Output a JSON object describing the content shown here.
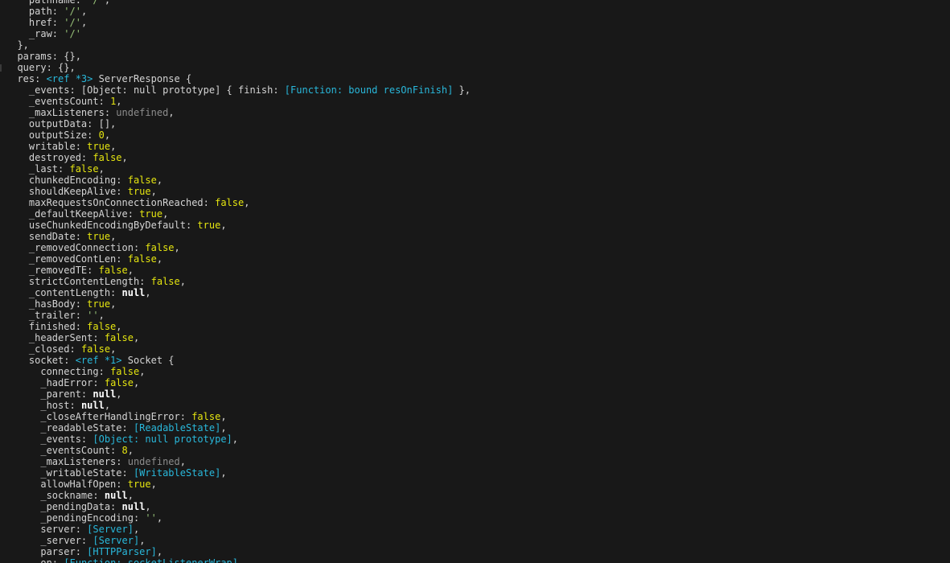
{
  "terminal": {
    "lines": [
      {
        "indent": 4,
        "segs": [
          {
            "c": "p",
            "t": "pathname: "
          },
          {
            "c": "s",
            "t": "'/'"
          },
          {
            "c": "p",
            "t": ","
          }
        ]
      },
      {
        "indent": 4,
        "segs": [
          {
            "c": "p",
            "t": "path: "
          },
          {
            "c": "s",
            "t": "'/'"
          },
          {
            "c": "p",
            "t": ","
          }
        ]
      },
      {
        "indent": 4,
        "segs": [
          {
            "c": "p",
            "t": "href: "
          },
          {
            "c": "s",
            "t": "'/'"
          },
          {
            "c": "p",
            "t": ","
          }
        ]
      },
      {
        "indent": 4,
        "segs": [
          {
            "c": "p",
            "t": "_raw: "
          },
          {
            "c": "s",
            "t": "'/'"
          }
        ]
      },
      {
        "indent": 2,
        "segs": [
          {
            "c": "p",
            "t": "},"
          }
        ]
      },
      {
        "indent": 2,
        "segs": [
          {
            "c": "p",
            "t": "params: {},"
          }
        ]
      },
      {
        "indent": 2,
        "segs": [
          {
            "c": "p",
            "t": "query: {},"
          }
        ]
      },
      {
        "indent": 2,
        "segs": [
          {
            "c": "p",
            "t": "res: "
          },
          {
            "c": "r",
            "t": "<ref *3>"
          },
          {
            "c": "p",
            "t": " ServerResponse {"
          }
        ]
      },
      {
        "indent": 4,
        "segs": [
          {
            "c": "p",
            "t": "_events: [Object: null prototype] { finish: "
          },
          {
            "c": "r",
            "t": "[Function: bound resOnFinish]"
          },
          {
            "c": "p",
            "t": " },"
          }
        ]
      },
      {
        "indent": 4,
        "segs": [
          {
            "c": "p",
            "t": "_eventsCount: "
          },
          {
            "c": "n",
            "t": "1"
          },
          {
            "c": "p",
            "t": ","
          }
        ]
      },
      {
        "indent": 4,
        "segs": [
          {
            "c": "p",
            "t": "_maxListeners: "
          },
          {
            "c": "u",
            "t": "undefined"
          },
          {
            "c": "p",
            "t": ","
          }
        ]
      },
      {
        "indent": 4,
        "segs": [
          {
            "c": "p",
            "t": "outputData: [],"
          }
        ]
      },
      {
        "indent": 4,
        "segs": [
          {
            "c": "p",
            "t": "outputSize: "
          },
          {
            "c": "n",
            "t": "0"
          },
          {
            "c": "p",
            "t": ","
          }
        ]
      },
      {
        "indent": 4,
        "segs": [
          {
            "c": "p",
            "t": "writable: "
          },
          {
            "c": "n",
            "t": "true"
          },
          {
            "c": "p",
            "t": ","
          }
        ]
      },
      {
        "indent": 4,
        "segs": [
          {
            "c": "p",
            "t": "destroyed: "
          },
          {
            "c": "n",
            "t": "false"
          },
          {
            "c": "p",
            "t": ","
          }
        ]
      },
      {
        "indent": 4,
        "segs": [
          {
            "c": "p",
            "t": "_last: "
          },
          {
            "c": "n",
            "t": "false"
          },
          {
            "c": "p",
            "t": ","
          }
        ]
      },
      {
        "indent": 4,
        "segs": [
          {
            "c": "p",
            "t": "chunkedEncoding: "
          },
          {
            "c": "n",
            "t": "false"
          },
          {
            "c": "p",
            "t": ","
          }
        ]
      },
      {
        "indent": 4,
        "segs": [
          {
            "c": "p",
            "t": "shouldKeepAlive: "
          },
          {
            "c": "n",
            "t": "true"
          },
          {
            "c": "p",
            "t": ","
          }
        ]
      },
      {
        "indent": 4,
        "segs": [
          {
            "c": "p",
            "t": "maxRequestsOnConnectionReached: "
          },
          {
            "c": "n",
            "t": "false"
          },
          {
            "c": "p",
            "t": ","
          }
        ]
      },
      {
        "indent": 4,
        "segs": [
          {
            "c": "p",
            "t": "_defaultKeepAlive: "
          },
          {
            "c": "n",
            "t": "true"
          },
          {
            "c": "p",
            "t": ","
          }
        ]
      },
      {
        "indent": 4,
        "segs": [
          {
            "c": "p",
            "t": "useChunkedEncodingByDefault: "
          },
          {
            "c": "n",
            "t": "true"
          },
          {
            "c": "p",
            "t": ","
          }
        ]
      },
      {
        "indent": 4,
        "segs": [
          {
            "c": "p",
            "t": "sendDate: "
          },
          {
            "c": "n",
            "t": "true"
          },
          {
            "c": "p",
            "t": ","
          }
        ]
      },
      {
        "indent": 4,
        "segs": [
          {
            "c": "p",
            "t": "_removedConnection: "
          },
          {
            "c": "n",
            "t": "false"
          },
          {
            "c": "p",
            "t": ","
          }
        ]
      },
      {
        "indent": 4,
        "segs": [
          {
            "c": "p",
            "t": "_removedContLen: "
          },
          {
            "c": "n",
            "t": "false"
          },
          {
            "c": "p",
            "t": ","
          }
        ]
      },
      {
        "indent": 4,
        "segs": [
          {
            "c": "p",
            "t": "_removedTE: "
          },
          {
            "c": "n",
            "t": "false"
          },
          {
            "c": "p",
            "t": ","
          }
        ]
      },
      {
        "indent": 4,
        "segs": [
          {
            "c": "p",
            "t": "strictContentLength: "
          },
          {
            "c": "n",
            "t": "false"
          },
          {
            "c": "p",
            "t": ","
          }
        ]
      },
      {
        "indent": 4,
        "segs": [
          {
            "c": "p",
            "t": "_contentLength: "
          },
          {
            "c": "nl",
            "t": "null"
          },
          {
            "c": "p",
            "t": ","
          }
        ]
      },
      {
        "indent": 4,
        "segs": [
          {
            "c": "p",
            "t": "_hasBody: "
          },
          {
            "c": "n",
            "t": "true"
          },
          {
            "c": "p",
            "t": ","
          }
        ]
      },
      {
        "indent": 4,
        "segs": [
          {
            "c": "p",
            "t": "_trailer: "
          },
          {
            "c": "s",
            "t": "''"
          },
          {
            "c": "p",
            "t": ","
          }
        ]
      },
      {
        "indent": 4,
        "segs": [
          {
            "c": "p",
            "t": "finished: "
          },
          {
            "c": "n",
            "t": "false"
          },
          {
            "c": "p",
            "t": ","
          }
        ]
      },
      {
        "indent": 4,
        "segs": [
          {
            "c": "p",
            "t": "_headerSent: "
          },
          {
            "c": "n",
            "t": "false"
          },
          {
            "c": "p",
            "t": ","
          }
        ]
      },
      {
        "indent": 4,
        "segs": [
          {
            "c": "p",
            "t": "_closed: "
          },
          {
            "c": "n",
            "t": "false"
          },
          {
            "c": "p",
            "t": ","
          }
        ]
      },
      {
        "indent": 4,
        "segs": [
          {
            "c": "p",
            "t": "socket: "
          },
          {
            "c": "r",
            "t": "<ref *1>"
          },
          {
            "c": "p",
            "t": " Socket {"
          }
        ]
      },
      {
        "indent": 6,
        "segs": [
          {
            "c": "p",
            "t": "connecting: "
          },
          {
            "c": "n",
            "t": "false"
          },
          {
            "c": "p",
            "t": ","
          }
        ]
      },
      {
        "indent": 6,
        "segs": [
          {
            "c": "p",
            "t": "_hadError: "
          },
          {
            "c": "n",
            "t": "false"
          },
          {
            "c": "p",
            "t": ","
          }
        ]
      },
      {
        "indent": 6,
        "segs": [
          {
            "c": "p",
            "t": "_parent: "
          },
          {
            "c": "nl",
            "t": "null"
          },
          {
            "c": "p",
            "t": ","
          }
        ]
      },
      {
        "indent": 6,
        "segs": [
          {
            "c": "p",
            "t": "_host: "
          },
          {
            "c": "nl",
            "t": "null"
          },
          {
            "c": "p",
            "t": ","
          }
        ]
      },
      {
        "indent": 6,
        "segs": [
          {
            "c": "p",
            "t": "_closeAfterHandlingError: "
          },
          {
            "c": "n",
            "t": "false"
          },
          {
            "c": "p",
            "t": ","
          }
        ]
      },
      {
        "indent": 6,
        "segs": [
          {
            "c": "p",
            "t": "_readableState: "
          },
          {
            "c": "r",
            "t": "[ReadableState]"
          },
          {
            "c": "p",
            "t": ","
          }
        ]
      },
      {
        "indent": 6,
        "segs": [
          {
            "c": "p",
            "t": "_events: "
          },
          {
            "c": "r",
            "t": "[Object: null prototype]"
          },
          {
            "c": "p",
            "t": ","
          }
        ]
      },
      {
        "indent": 6,
        "segs": [
          {
            "c": "p",
            "t": "_eventsCount: "
          },
          {
            "c": "n",
            "t": "8"
          },
          {
            "c": "p",
            "t": ","
          }
        ]
      },
      {
        "indent": 6,
        "segs": [
          {
            "c": "p",
            "t": "_maxListeners: "
          },
          {
            "c": "u",
            "t": "undefined"
          },
          {
            "c": "p",
            "t": ","
          }
        ]
      },
      {
        "indent": 6,
        "segs": [
          {
            "c": "p",
            "t": "_writableState: "
          },
          {
            "c": "r",
            "t": "[WritableState]"
          },
          {
            "c": "p",
            "t": ","
          }
        ]
      },
      {
        "indent": 6,
        "segs": [
          {
            "c": "p",
            "t": "allowHalfOpen: "
          },
          {
            "c": "n",
            "t": "true"
          },
          {
            "c": "p",
            "t": ","
          }
        ]
      },
      {
        "indent": 6,
        "segs": [
          {
            "c": "p",
            "t": "_sockname: "
          },
          {
            "c": "nl",
            "t": "null"
          },
          {
            "c": "p",
            "t": ","
          }
        ]
      },
      {
        "indent": 6,
        "segs": [
          {
            "c": "p",
            "t": "_pendingData: "
          },
          {
            "c": "nl",
            "t": "null"
          },
          {
            "c": "p",
            "t": ","
          }
        ]
      },
      {
        "indent": 6,
        "segs": [
          {
            "c": "p",
            "t": "_pendingEncoding: "
          },
          {
            "c": "s",
            "t": "''"
          },
          {
            "c": "p",
            "t": ","
          }
        ]
      },
      {
        "indent": 6,
        "segs": [
          {
            "c": "p",
            "t": "server: "
          },
          {
            "c": "r",
            "t": "[Server]"
          },
          {
            "c": "p",
            "t": ","
          }
        ]
      },
      {
        "indent": 6,
        "segs": [
          {
            "c": "p",
            "t": "_server: "
          },
          {
            "c": "r",
            "t": "[Server]"
          },
          {
            "c": "p",
            "t": ","
          }
        ]
      },
      {
        "indent": 6,
        "segs": [
          {
            "c": "p",
            "t": "parser: "
          },
          {
            "c": "r",
            "t": "[HTTPParser]"
          },
          {
            "c": "p",
            "t": ","
          }
        ]
      },
      {
        "indent": 6,
        "segs": [
          {
            "c": "p",
            "t": "on: "
          },
          {
            "c": "r",
            "t": "[Function: socketListenerWrap]"
          },
          {
            "c": "p",
            "t": ","
          }
        ]
      }
    ]
  }
}
